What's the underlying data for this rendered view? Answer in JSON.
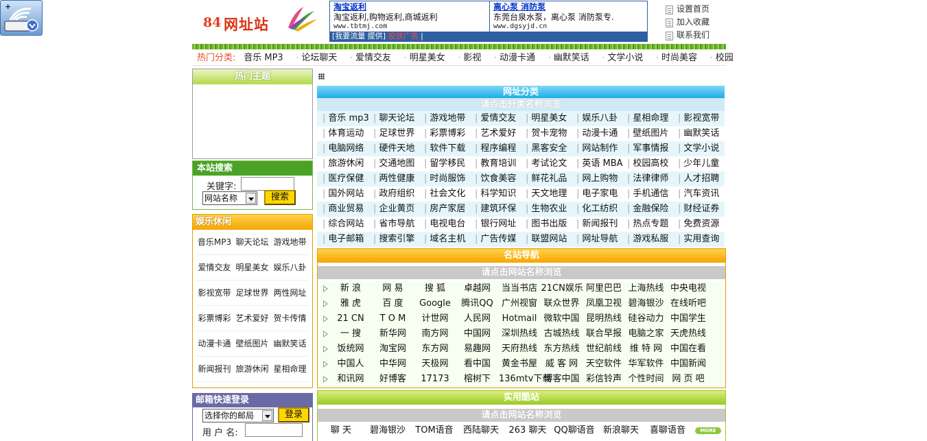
{
  "site": {
    "logo_num": "84",
    "logo_text": "网址站"
  },
  "ads": [
    {
      "title": "淘宝返利",
      "text": "淘宝返利,购物返利,商城返利",
      "url": "www.tbtmj.com"
    },
    {
      "title": "离心泵 消防泵",
      "text": "东莞台泉水泵，离心泵 消防泵专.",
      "url": "www.dgsyjd.cn"
    }
  ],
  "ad_bar": {
    "text": "[我要流量 提供]",
    "hot": "投放广告",
    "tail": "|"
  },
  "quick_links": [
    "设置首页",
    "加入收藏",
    "联系我们"
  ],
  "hotnav": {
    "label": "热门分类:",
    "items": [
      "音乐 MP3",
      "论坛聊天",
      "爱情交友",
      "明星美女",
      "影视",
      "动漫卡通",
      "幽默笑话",
      "文学小说",
      "时尚美容",
      "校园"
    ]
  },
  "left": {
    "hot_topics_title": "热门主题",
    "search": {
      "title": "本站搜索",
      "keyword_label": "关键字:",
      "scope_value": "网站名称",
      "button": "搜索"
    },
    "ent": {
      "title": "娱乐休闲",
      "items": [
        "音乐MP3",
        "聊天论坛",
        "游戏地带",
        "爱情交友",
        "明星美女",
        "娱乐八卦",
        "影视宽带",
        "足球世界",
        "两性网址",
        "彩票博彩",
        "艺术爱好",
        "贺卡传情",
        "动漫卡通",
        "壁纸图片",
        "幽默笑话",
        "新闻报刊",
        "旅游休闲",
        "星相命理"
      ]
    },
    "mail": {
      "title": "邮箱快速登录",
      "select_value": "选择你的邮局",
      "button": "登录",
      "user_label": "用 户 名:"
    }
  },
  "main": {
    "categories": {
      "title": "网址分类",
      "subtitle": "请点击分类名称浏览",
      "rows": [
        [
          "音乐 mp3",
          "聊天论坛",
          "游戏地带",
          "爱情交友",
          "明星美女",
          "娱乐八卦",
          "星相命理",
          "影视宽带"
        ],
        [
          "体育运动",
          "足球世界",
          "彩票博彩",
          "艺术爱好",
          "贺卡宠物",
          "动漫卡通",
          "壁纸图片",
          "幽默笑话"
        ],
        [
          "电脑网络",
          "硬件天地",
          "软件下载",
          "程序编程",
          "黑客安全",
          "网站制作",
          "军事情报",
          "文学小说"
        ],
        [
          "旅游休闲",
          "交通地图",
          "留学移民",
          "教育培训",
          "考试论文",
          "英语 MBA",
          "校园高校",
          "少年儿童"
        ],
        [
          "医疗保健",
          "两性健康",
          "时尚服饰",
          "饮食美容",
          "鲜花礼品",
          "网上购物",
          "法律律师",
          "人才招聘"
        ],
        [
          "国外网站",
          "政府组织",
          "社会文化",
          "科学知识",
          "天文地理",
          "电子家电",
          "手机通信",
          "汽车资讯"
        ],
        [
          "商业贸易",
          "企业黄页",
          "房产家居",
          "建筑环保",
          "生物农业",
          "化工纺织",
          "金融保险",
          "财经证券"
        ],
        [
          "综合网站",
          "省市导航",
          "电视电台",
          "银行网址",
          "图书出版",
          "新闻报刊",
          "热点专题",
          "免费资源"
        ],
        [
          "电子邮箱",
          "搜索引擎",
          "域名主机",
          "广告传媒",
          "联盟网站",
          "网址导航",
          "游戏私服",
          "实用查询"
        ]
      ]
    },
    "famous": {
      "title": "名站导航",
      "subtitle": "请点击网站名称浏览",
      "rows": [
        [
          "新 浪",
          "网 易",
          "搜 狐",
          "卓越网",
          "当当书店",
          "21CN娱乐",
          "阿里巴巴",
          "上海热线",
          "中央电视"
        ],
        [
          "雅 虎",
          "百 度",
          "Google",
          "腾讯QQ",
          "广州视窗",
          "联众世界",
          "凤凰卫视",
          "碧海银沙",
          "在线听吧"
        ],
        [
          "21 CN",
          "T O M",
          "计世网",
          "人民网",
          "Hotmail",
          "微软中国",
          "昆明热线",
          "硅谷动力",
          "中国学生"
        ],
        [
          "一 搜",
          "新华网",
          "南方网",
          "中国网",
          "深圳热线",
          "古城热线",
          "联合早报",
          "电脑之家",
          "天虎热线"
        ],
        [
          "饭统网",
          "淘宝网",
          "东方网",
          "易趣网",
          "天府热线",
          "东方热线",
          "世纪前线",
          "维 特 网",
          "中国在看"
        ],
        [
          "中国人",
          "中华网",
          "天极网",
          "看中国",
          "黄金书屋",
          "威 客 网",
          "天空软件",
          "华军软件",
          "中国新闻"
        ],
        [
          "和讯网",
          "好博客",
          "17173",
          "榕树下",
          "136mtv下载",
          "博客中国",
          "彩信铃声",
          "个性时间",
          "网 页 吧"
        ]
      ]
    },
    "cool": {
      "title": "实用酷站",
      "subtitle": "请点击网站名称浏览",
      "row": [
        "聊 天",
        "碧海银沙",
        "TOM语音",
        "西陆聊天",
        "263 聊天",
        "QQ聊语音",
        "新浪聊天",
        "喜聊语音"
      ],
      "more": "MORE"
    }
  }
}
